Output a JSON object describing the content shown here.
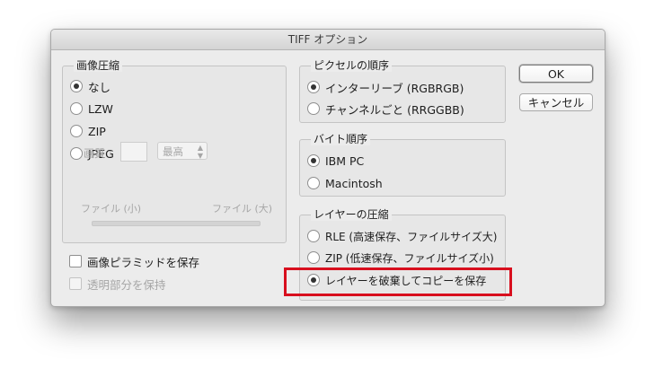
{
  "window": {
    "title": "TIFF オプション"
  },
  "compression": {
    "legend": "画像圧縮",
    "options": [
      {
        "label": "なし",
        "selected": true
      },
      {
        "label": "LZW",
        "selected": false
      },
      {
        "label": "ZIP",
        "selected": false
      },
      {
        "label": "JPEG",
        "selected": false
      }
    ],
    "quality_label": "画質 :",
    "quality_select": "最高",
    "file_small": "ファイル (小)",
    "file_large": "ファイル (大)"
  },
  "pixel_order": {
    "legend": "ピクセルの順序",
    "options": [
      {
        "label": "インターリーブ (RGBRGB)",
        "selected": true
      },
      {
        "label": "チャンネルごと (RRGGBB)",
        "selected": false
      }
    ]
  },
  "byte_order": {
    "legend": "バイト順序",
    "options": [
      {
        "label": "IBM PC",
        "selected": true
      },
      {
        "label": "Macintosh",
        "selected": false
      }
    ]
  },
  "layer_compression": {
    "legend": "レイヤーの圧縮",
    "options": [
      {
        "label": "RLE (高速保存、ファイルサイズ大)",
        "selected": false
      },
      {
        "label": "ZIP (低速保存、ファイルサイズ小)",
        "selected": false
      },
      {
        "label": "レイヤーを破棄してコピーを保存",
        "selected": true
      }
    ]
  },
  "checkboxes": {
    "save_pyramid": "画像ピラミッドを保存",
    "save_transparency": "透明部分を保持"
  },
  "buttons": {
    "ok": "OK",
    "cancel": "キャンセル"
  },
  "colors": {
    "highlight": "#d80f1e"
  }
}
